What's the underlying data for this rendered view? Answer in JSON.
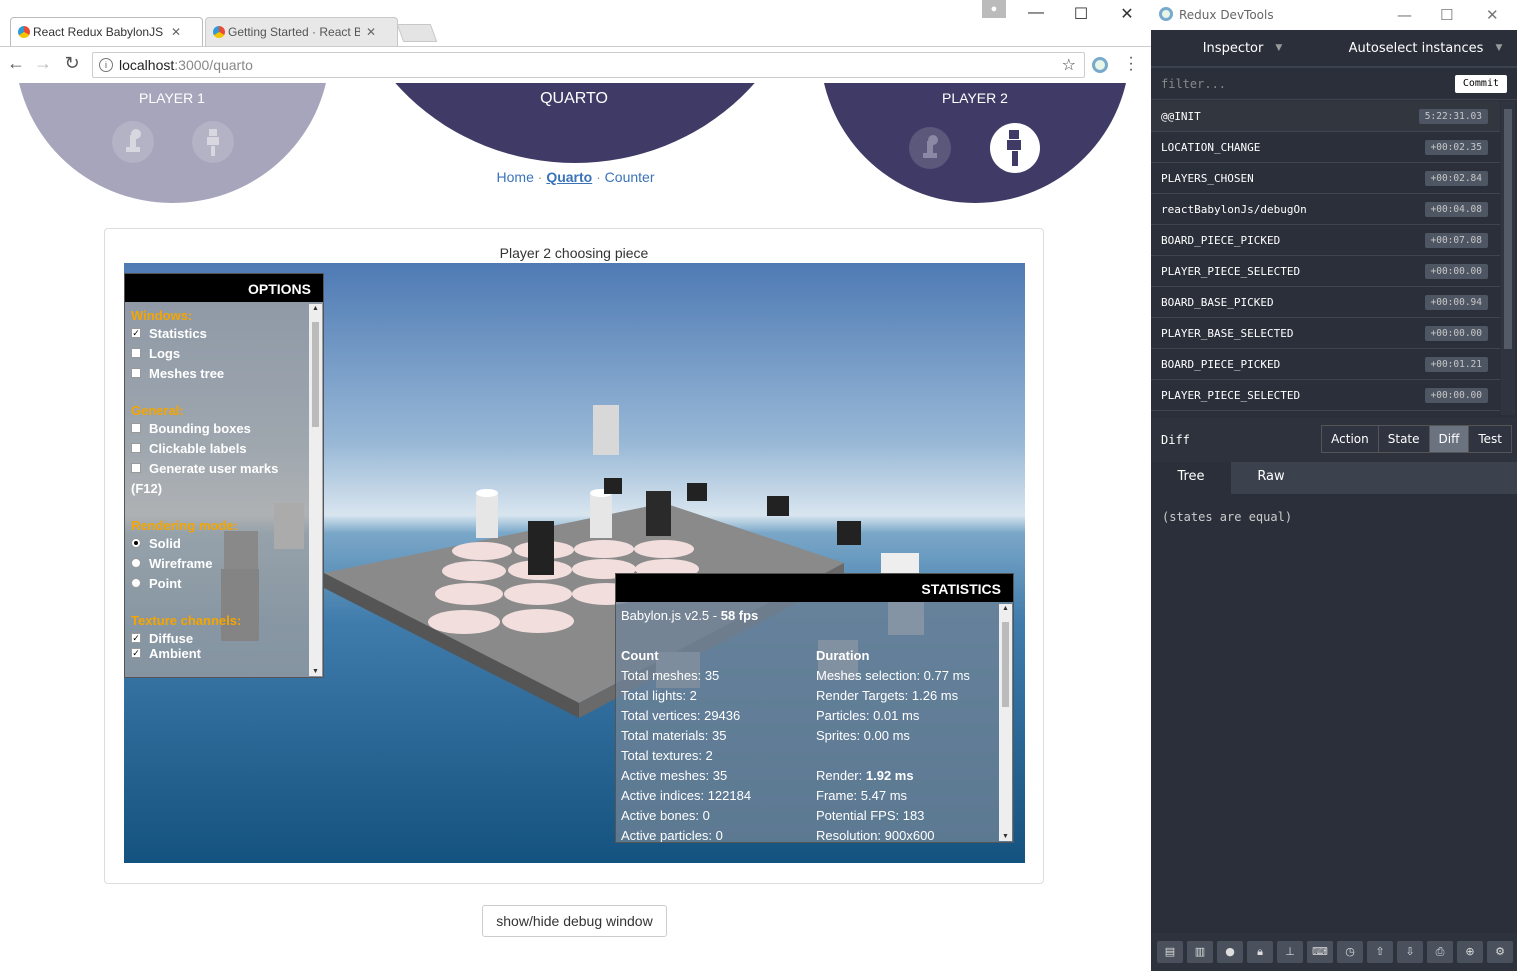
{
  "browser": {
    "tabs": [
      {
        "title": "React Redux BabylonJS S",
        "active": true
      },
      {
        "title": "Getting Started · React B",
        "active": false
      }
    ],
    "url_host": "localhost",
    "url_path": ":3000/quarto"
  },
  "header": {
    "player1": "PLAYER 1",
    "title": "QUARTO",
    "player2": "PLAYER 2"
  },
  "nav": {
    "home": "Home",
    "quarto": "Quarto",
    "counter": "Counter",
    "sep": "·"
  },
  "game": {
    "status": "Player 2 choosing piece",
    "debug_button": "show/hide debug window"
  },
  "options_panel": {
    "title": "OPTIONS",
    "windows_label": "Windows:",
    "statistics": "Statistics",
    "logs": "Logs",
    "meshes_tree": "Meshes tree",
    "general_label": "General:",
    "bounding_boxes": "Bounding boxes",
    "clickable_labels": "Clickable labels",
    "generate_user_marks": "Generate user marks",
    "f12": "(F12)",
    "rendering_label": "Rendering mode:",
    "solid": "Solid",
    "wireframe": "Wireframe",
    "point": "Point",
    "texture_label": "Texture channels:",
    "diffuse": "Diffuse",
    "ambient": "Ambient"
  },
  "statistics_panel": {
    "title": "STATISTICS",
    "version": "Babylon.js v2.5 - ",
    "fps": "58 fps",
    "count_head": "Count",
    "duration_head": "Duration",
    "count": [
      "Total meshes: 35",
      "Total lights: 2",
      "Total vertices: 29436",
      "Total materials: 35",
      "Total textures: 2",
      "Active meshes: 35",
      "Active indices: 122184",
      "Active bones: 0",
      "Active particles: 0"
    ],
    "duration": [
      "Meshes selection: 0.77 ms",
      "Render Targets: 1.26 ms",
      "Particles: 0.01 ms",
      "Sprites: 0.00 ms",
      "",
      "Render: ",
      "Frame: 5.47 ms",
      "Potential FPS: 183",
      "Resolution: 900x600"
    ],
    "render_value": "1.92 ms"
  },
  "devtools": {
    "title": "Redux DevTools",
    "inspector": "Inspector",
    "autoselect": "Autoselect instances",
    "filter_placeholder": "filter...",
    "commit": "Commit",
    "actions": [
      {
        "name": "@@INIT",
        "time": "5:22:31.03"
      },
      {
        "name": "LOCATION_CHANGE",
        "time": "+00:02.35"
      },
      {
        "name": "PLAYERS_CHOSEN",
        "time": "+00:02.84"
      },
      {
        "name": "reactBabylonJs/debugOn",
        "time": "+00:04.08"
      },
      {
        "name": "BOARD_PIECE_PICKED",
        "time": "+00:07.08"
      },
      {
        "name": "PLAYER_PIECE_SELECTED",
        "time": "+00:00.00"
      },
      {
        "name": "BOARD_BASE_PICKED",
        "time": "+00:00.94"
      },
      {
        "name": "PLAYER_BASE_SELECTED",
        "time": "+00:00.00"
      },
      {
        "name": "BOARD_PIECE_PICKED",
        "time": "+00:01.21"
      },
      {
        "name": "PLAYER_PIECE_SELECTED",
        "time": "+00:00.00"
      }
    ],
    "diff_label": "Diff",
    "mode_tabs": [
      "Action",
      "State",
      "Diff",
      "Test"
    ],
    "tree": "Tree",
    "raw": "Raw",
    "equal_msg": "(states are equal)",
    "colors": {
      "background": "#2a2f3a",
      "accent": "#6b7280"
    }
  },
  "colors": {
    "circle_dark": "#403b66",
    "circle_light": "#a7a5bb",
    "link": "#3a73b8",
    "options_section": "#f5a500"
  }
}
